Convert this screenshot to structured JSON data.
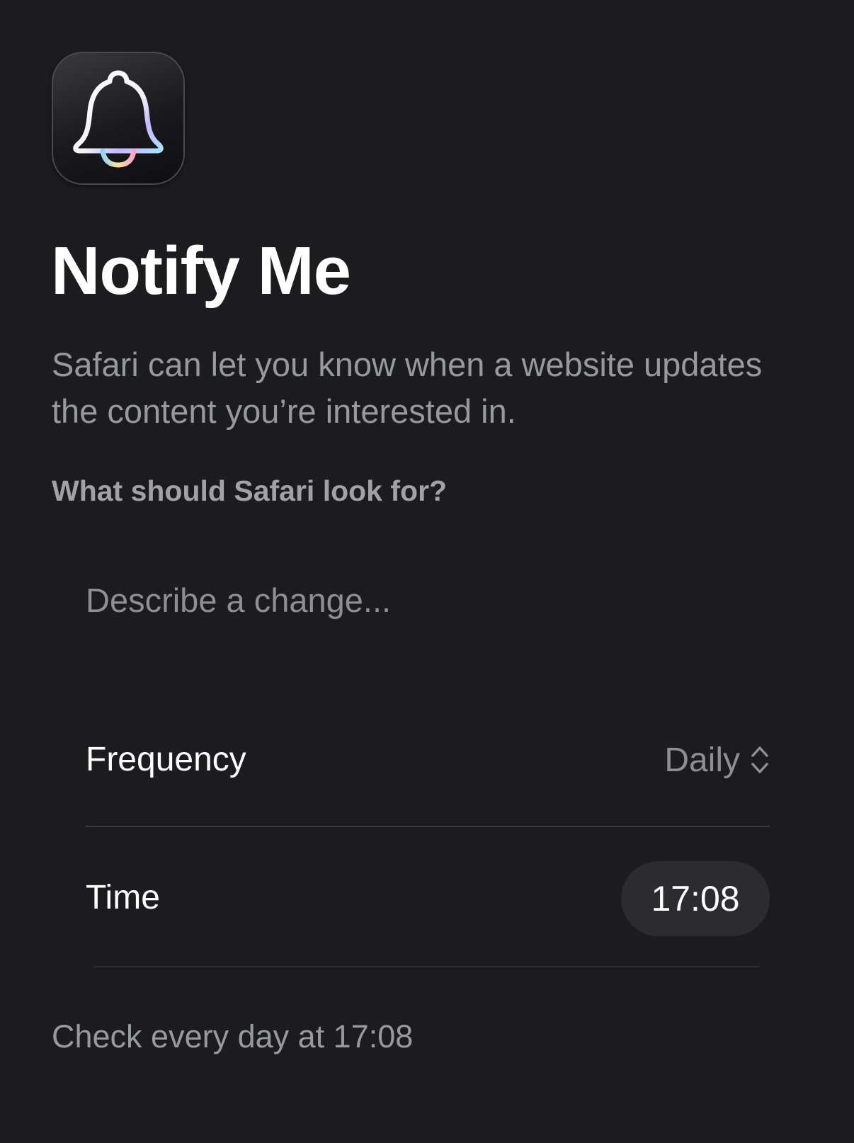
{
  "app": {
    "icon": "bell-icon"
  },
  "header": {
    "title": "Notify Me",
    "description": "Safari can let you know when a website updates the content you’re interested in."
  },
  "form": {
    "prompt_label": "What should Safari look for?",
    "change_input": {
      "placeholder": "Describe a change...",
      "value": ""
    },
    "frequency": {
      "label": "Frequency",
      "value": "Daily",
      "icon": "chevron-updown-icon"
    },
    "time": {
      "label": "Time",
      "value": "17:08"
    },
    "summary": "Check every day at 17:08"
  },
  "colors": {
    "background": "#1c1c1e",
    "primary_text": "#ffffff",
    "secondary_text": "#98989f",
    "pill_background": "#2c2c2e"
  }
}
